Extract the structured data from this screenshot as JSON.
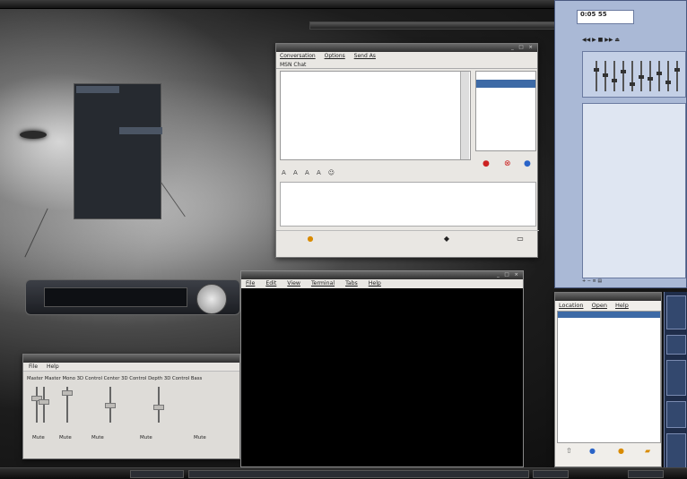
{
  "top_panel": {
    "clock": "—",
    "tray": "▮ ▮ ▮ ▮ ▮"
  },
  "menu": {
    "col1": [
      "",
      "",
      "",
      "",
      "",
      "",
      "",
      "",
      "",
      "",
      "",
      "",
      "",
      "",
      "",
      "",
      "",
      "",
      "",
      ""
    ],
    "col2": [
      "",
      "",
      "",
      "",
      "",
      "",
      "",
      "",
      "",
      "",
      "",
      "",
      ""
    ]
  },
  "chat": {
    "menus": [
      "Conversation",
      "Options",
      "Send As"
    ],
    "tab_label": "MSN Chat",
    "log": [
      "",
      "",
      "",
      "",
      "",
      "",
      "",
      "",
      "",
      "",
      ""
    ],
    "users": [
      "",
      "",
      "",
      ""
    ],
    "bottom_labels": [
      "",
      "",
      ""
    ]
  },
  "player": {
    "display_text": "0:05 55",
    "eq_label": "",
    "playlist_header": "",
    "tracks": [
      "",
      "",
      "",
      "",
      "",
      "",
      "",
      "",
      "",
      "",
      "",
      "",
      "",
      "",
      "",
      "",
      "",
      "",
      "",
      "",
      "",
      "",
      "",
      "",
      "",
      "",
      "",
      "",
      "",
      "",
      "",
      "",
      "",
      "",
      ""
    ]
  },
  "mixer": {
    "menus": [
      "File",
      "Help"
    ],
    "channel_labels": [
      "Master",
      "Master Mono",
      "3D Control",
      "Center",
      "3D Control",
      "Depth",
      "3D Control",
      "Bass"
    ],
    "mute_labels": [
      "Mute",
      "Mute",
      "Mute",
      "Mute",
      "Mute"
    ]
  },
  "terminal": {
    "menus": [
      "File",
      "Edit",
      "View",
      "Terminal",
      "Tabs",
      "Help"
    ],
    "prompt": ""
  },
  "files": {
    "menus": [
      "Location",
      "Open",
      "Help"
    ],
    "root": "",
    "items": [
      "",
      "",
      "",
      "",
      "",
      "",
      "",
      "",
      "",
      "",
      "",
      "",
      "",
      "",
      "",
      "",
      "",
      "",
      ""
    ],
    "buttons": [
      "",
      "",
      "",
      "",
      ""
    ]
  },
  "taskbar": {
    "items": [
      "",
      "",
      "",
      ""
    ]
  }
}
